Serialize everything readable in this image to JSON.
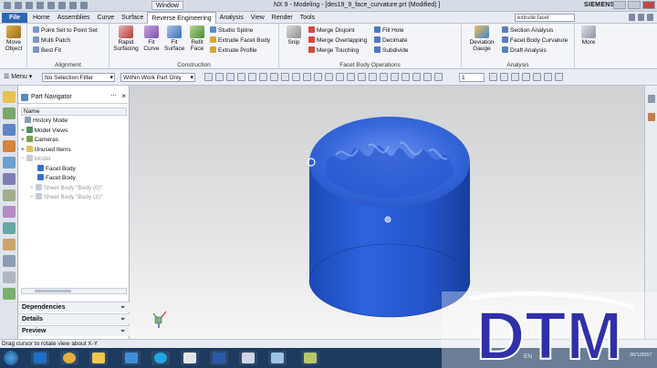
{
  "titlebar": {
    "window_menu": "Window",
    "title": "NX 9 - Modeling - [des19_9_face_curvature.prt (Modified) ]",
    "brand": "SIEMENS"
  },
  "menubar": {
    "file": "File",
    "tabs": [
      "Home",
      "Assemblies",
      "Curve",
      "Surface",
      "Reverse Engineering",
      "Analysis",
      "View",
      "Render",
      "Tools"
    ],
    "active_tab": "Reverse Engineering",
    "search_value": "extrude facet"
  },
  "ribbon": {
    "move_object": "Move Object",
    "alignment": {
      "label": "Alignment",
      "items": [
        "Point Set to Point Set",
        "Multi Patch",
        "Best Fit"
      ]
    },
    "construction": {
      "label": "Construction",
      "big": [
        "Rapid Surfacing",
        "Fit Curve",
        "Fit Surface",
        "Refit Face"
      ],
      "items": [
        "Studio Spline",
        "Extrude Facet Body",
        "Extrude Profile"
      ]
    },
    "snip": "Snip",
    "facet_ops": {
      "label": "Facet Body Operations",
      "items_a": [
        "Merge Disjoint",
        "Merge Overlapping",
        "Merge Touching"
      ],
      "items_b": [
        "Fill Hole",
        "Decimate",
        "Subdivide"
      ]
    },
    "analysis": {
      "label": "Analysis",
      "big": "Deviation Gauge",
      "items": [
        "Section Analysis",
        "Facet Body Curvature",
        "Draft Analysis"
      ]
    },
    "more": "More"
  },
  "toolbar": {
    "menu": "Menu",
    "selection_filter": "No Selection Filter",
    "scope": "Within Work Part Only",
    "layer": "1"
  },
  "navigator": {
    "title": "Part Navigator",
    "column": "Name",
    "rows": [
      {
        "label": "History Mode",
        "dim": false
      },
      {
        "label": "Model Views",
        "dim": false
      },
      {
        "label": "Cameras",
        "dim": false
      },
      {
        "label": "Unused Items",
        "dim": false
      },
      {
        "label": "Model",
        "dim": true
      },
      {
        "label": "Facet Body",
        "dim": false
      },
      {
        "label": "Facet Body",
        "dim": false
      },
      {
        "label": "Sheet Body \"Body (0)\"",
        "dim": true
      },
      {
        "label": "Sheet Body \"Body (2)\"",
        "dim": true
      }
    ],
    "panels": [
      "Dependencies",
      "Details",
      "Preview"
    ]
  },
  "status_text": "Drag cursor to rotate view about X-Y",
  "watermark": "DTM",
  "taskbar": {
    "tray_lang": "EN",
    "clock": "30/1/2557"
  },
  "colors": {
    "model_blue": "#2a5fd6",
    "file_tab": "#2e66b5",
    "watermark_blue": "#3030a8"
  }
}
